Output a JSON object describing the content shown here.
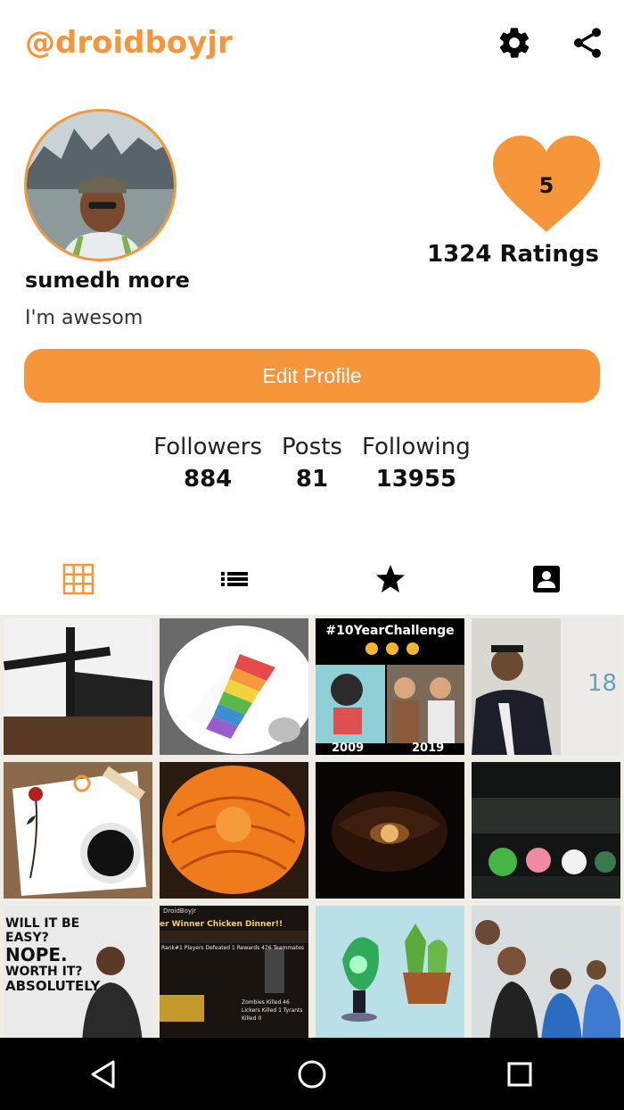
{
  "header": {
    "username": "@droidboyjr",
    "settings_icon": "gear-icon",
    "share_icon": "share-icon"
  },
  "profile": {
    "display_name": "sumedh more",
    "bio": "I'm awesom",
    "rating_value": "5",
    "ratings_text": "1324 Ratings",
    "edit_button": "Edit Profile"
  },
  "stats": [
    {
      "label": "Followers",
      "value": "884"
    },
    {
      "label": "Posts",
      "value": "81"
    },
    {
      "label": "Following",
      "value": "13955"
    }
  ],
  "tabs": [
    {
      "icon": "grid-icon",
      "active": true
    },
    {
      "icon": "list-icon",
      "active": false
    },
    {
      "icon": "star-icon",
      "active": false
    },
    {
      "icon": "contact-icon",
      "active": false
    }
  ],
  "posts": {
    "tile3": {
      "title": "#10YearChallenge",
      "left_year": "2009",
      "right_year": "2019"
    },
    "tile4": {
      "number": "18"
    },
    "tile9": {
      "lines": [
        "WILL IT BE",
        "EASY?",
        "NOPE.",
        "WORTH IT?",
        "ABSOLUTELY"
      ]
    },
    "tile10": {
      "header": "DroidBoyJr",
      "banner": "er Winner Chicken Dinner!!",
      "row": "Rank#1 Players Defeated 1 Rewards 476 Teammates",
      "stats": "Zombies Killed 46  Lickers Killed 1  Tyrants Killed 0"
    }
  },
  "colors": {
    "accent": "#f7953b",
    "navbar": "#000000"
  },
  "navbar": {
    "back_icon": "back-triangle-icon",
    "home_icon": "home-circle-icon",
    "recents_icon": "recents-square-icon"
  }
}
